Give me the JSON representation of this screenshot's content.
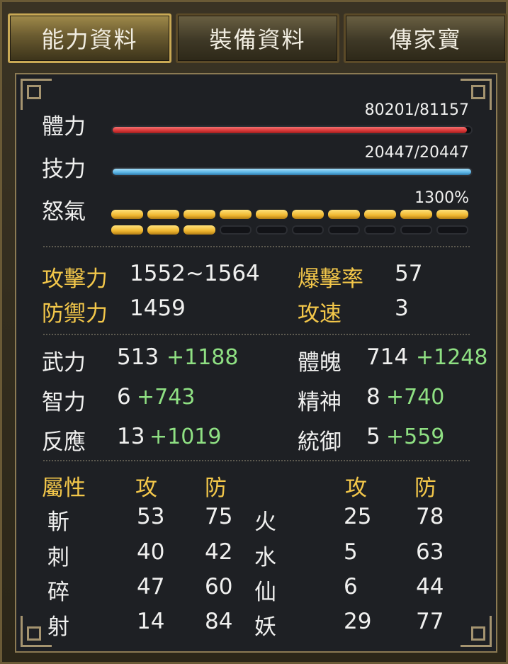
{
  "tabs": [
    {
      "label": "能力資料",
      "active": true
    },
    {
      "label": "裝備資料",
      "active": false
    },
    {
      "label": "傳家寶",
      "active": false
    }
  ],
  "bars": {
    "hp": {
      "label": "體力",
      "current": 80201,
      "max": 81157,
      "text": "80201/81157",
      "color": "#d83535"
    },
    "sp": {
      "label": "技力",
      "current": 20447,
      "max": 20447,
      "text": "20447/20447",
      "color": "#58b3e5"
    },
    "rage": {
      "label": "怒氣",
      "text": "1300%",
      "filled_segments": 13,
      "total_segments": 20,
      "color": "#f0b730"
    }
  },
  "combat": {
    "attack": {
      "label": "攻擊力",
      "value": "1552~1564"
    },
    "defense": {
      "label": "防禦力",
      "value": "1459"
    },
    "crit": {
      "label": "爆擊率",
      "value": "57"
    },
    "speed": {
      "label": "攻速",
      "value": "3"
    }
  },
  "attributes": [
    {
      "label": "武力",
      "base": "513",
      "bonus": "+1188"
    },
    {
      "label": "智力",
      "base": "6",
      "bonus": "+743"
    },
    {
      "label": "反應",
      "base": "13",
      "bonus": "+1019"
    },
    {
      "label": "體魄",
      "base": "714",
      "bonus": "+1248"
    },
    {
      "label": "精神",
      "base": "8",
      "bonus": "+740"
    },
    {
      "label": "統御",
      "base": "5",
      "bonus": "+559"
    }
  ],
  "elements": {
    "header": {
      "title": "屬性",
      "atk": "攻",
      "def": "防",
      "atk2": "攻",
      "def2": "防"
    },
    "rows": [
      {
        "name": "斬",
        "atk": "53",
        "def": "75",
        "name2": "火",
        "atk2": "25",
        "def2": "78"
      },
      {
        "name": "刺",
        "atk": "40",
        "def": "42",
        "name2": "水",
        "atk2": "5",
        "def2": "63"
      },
      {
        "name": "碎",
        "atk": "47",
        "def": "60",
        "name2": "仙",
        "atk2": "6",
        "def2": "44"
      },
      {
        "name": "射",
        "atk": "14",
        "def": "84",
        "name2": "妖",
        "atk2": "29",
        "def2": "77"
      }
    ]
  }
}
